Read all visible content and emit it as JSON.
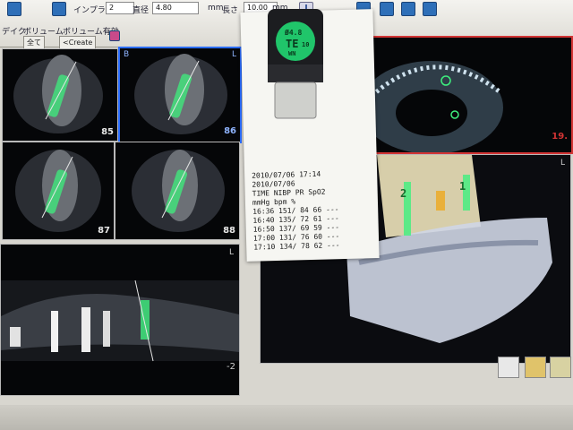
{
  "toolbar": {
    "implant_label": "インプラント",
    "implant_value": "2",
    "diameter_label": "直径",
    "diameter_value": "4.80",
    "diameter_unit": "mm",
    "length_label": "長さ",
    "length_value": "10.00",
    "length_unit": "mm",
    "tab_label": "デイク",
    "volume_label": "ボリューム",
    "volume_enabled_label": "ボリューム有効",
    "all_label": "全て",
    "create_label": "<Create"
  },
  "panels": {
    "p1_number": "85",
    "p2_number": "86",
    "p2_corner": "B",
    "p2_corner_right": "L",
    "p3_number": "87",
    "p4_number": "88",
    "p5_corner": "L",
    "p5_number": "-2",
    "p6_number": "19.",
    "p7_corner": "L"
  },
  "vial": {
    "line1": "Ø4.8",
    "line2": "TE",
    "line3": "10",
    "line4": "WN"
  },
  "receipt": {
    "lines": [
      "2010/07/06  17:14",
      "2010/07/06",
      "TIME  NIBP   PR  SpO2",
      "       mmHg   bpm   %",
      "16:36 151/ 84  66  ---",
      "16:40 135/ 72  61  ---",
      "16:50 137/ 69  59  ---",
      "17:00 131/ 76  60  ---",
      "17:10 134/ 78  62  ---"
    ]
  },
  "implant_markers": {
    "m1": "2",
    "m2": "1"
  }
}
